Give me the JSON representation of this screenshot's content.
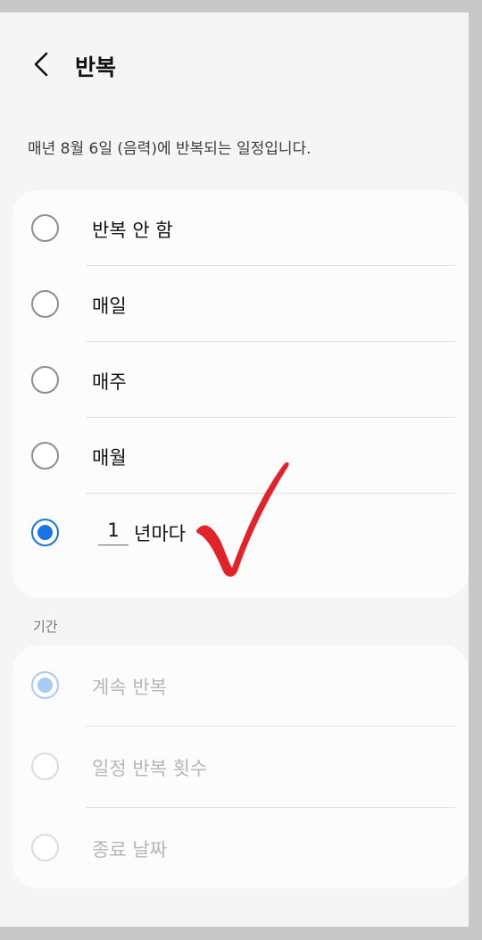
{
  "header": {
    "title": "반복",
    "back_icon": "chevron-left-icon"
  },
  "description": "매년 8월 6일 (음력)에 반복되는 일정입니다.",
  "repeat_options": [
    {
      "label": "반복 안 함",
      "selected": false
    },
    {
      "label": "매일",
      "selected": false
    },
    {
      "label": "매주",
      "selected": false
    },
    {
      "label": "매월",
      "selected": false
    }
  ],
  "yearly_option": {
    "interval_value": "1",
    "suffix": "년마다",
    "selected": true
  },
  "period_section": {
    "label": "기간",
    "options": [
      {
        "label": "계속 반복",
        "selected": true,
        "enabled": false
      },
      {
        "label": "일정 반복 횟수",
        "selected": false,
        "enabled": false
      },
      {
        "label": "종료 날짜",
        "selected": false,
        "enabled": false
      }
    ]
  },
  "annotation": {
    "icon": "red-checkmark-annotation",
    "color": "#e3232a"
  },
  "colors": {
    "accent": "#1a73e8",
    "background": "#f5f5f5",
    "card": "#fcfcfc"
  }
}
